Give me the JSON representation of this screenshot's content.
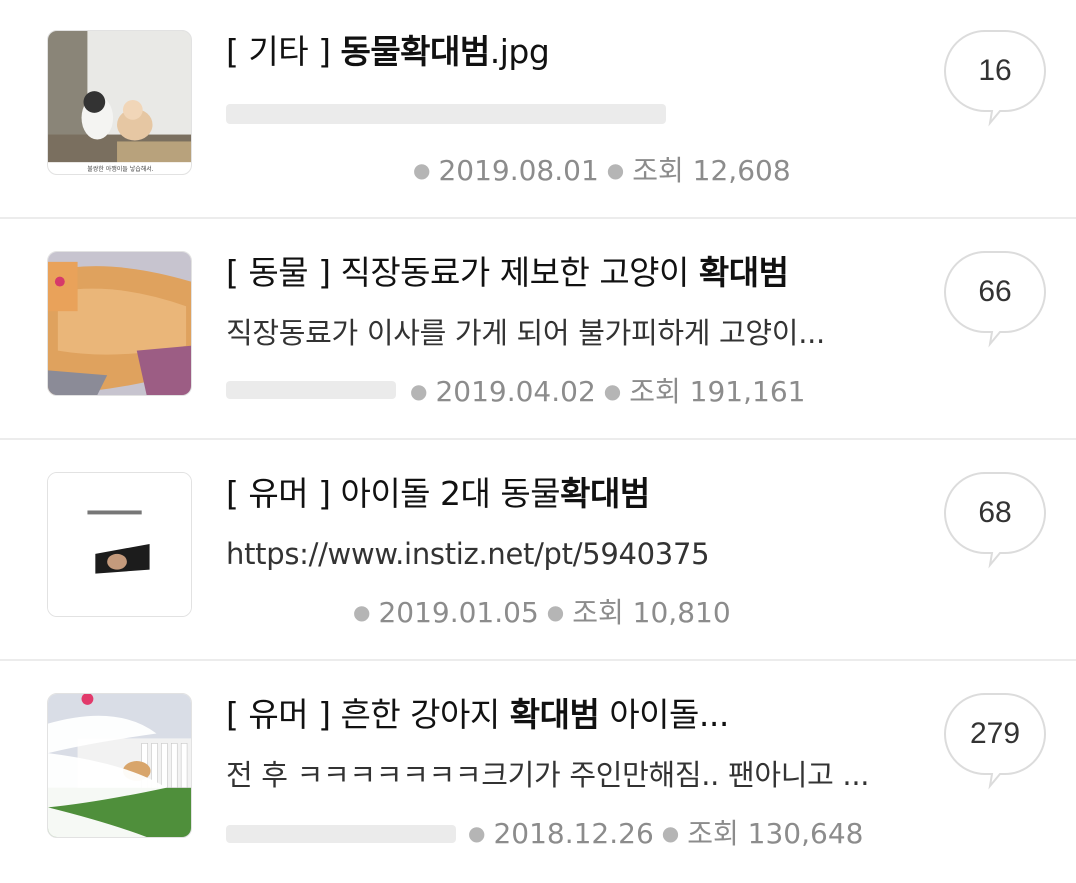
{
  "posts": [
    {
      "category": "[ 기타 ]",
      "title_plain": "",
      "title_highlight": "동물확대범",
      "title_suffix": ".jpg",
      "snippet": "",
      "date": "2019.08.01",
      "views_label": "조회",
      "views": "12,608",
      "comments": "16",
      "thumb_caption": "불쌍한 아깽이들 낳습해서."
    },
    {
      "category": "[ 동물 ]",
      "title_plain": "직장동료가 제보한 고양이 ",
      "title_highlight": "확대범",
      "title_suffix": "",
      "snippet": "직장동료가 이사를 가게 되어 불가피하게 고양이...",
      "date": "2019.04.02",
      "views_label": "조회",
      "views": "191,161",
      "comments": "66"
    },
    {
      "category": "[ 유머 ]",
      "title_plain": "아이돌 2대 동물",
      "title_highlight": "확대범",
      "title_suffix": "",
      "snippet": "https://www.instiz.net/pt/5940375",
      "date": "2019.01.05",
      "views_label": "조회",
      "views": "10,810",
      "comments": "68"
    },
    {
      "category": "[ 유머 ]",
      "title_plain": "흔한 강아지 ",
      "title_highlight": "확대범",
      "title_suffix": " 아이돌...",
      "snippet": "전 후 ㅋㅋㅋㅋㅋㅋㅋ크기가 주인만해짐.. 팬아니고 ...",
      "date": "2018.12.26",
      "views_label": "조회",
      "views": "130,648",
      "comments": "279"
    }
  ],
  "colors": {
    "text": "#111111",
    "meta": "#8c8c8c",
    "divider": "#ececec",
    "bubble_border": "#dcdcdc"
  }
}
